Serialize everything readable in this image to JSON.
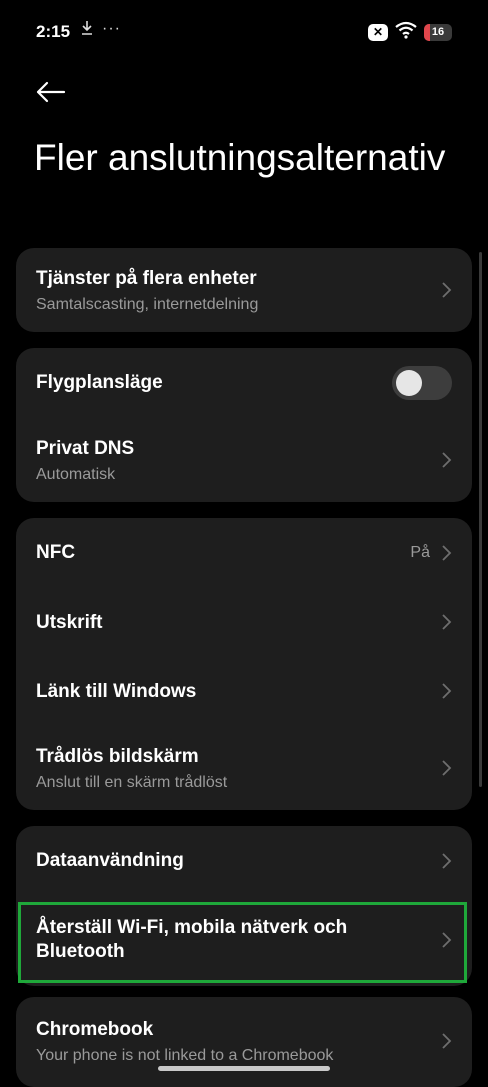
{
  "status_bar": {
    "time": "2:15",
    "download_icon": "download-icon",
    "more": "···",
    "battery_level": "16"
  },
  "header": {
    "title": "Fler anslutningsalternativ"
  },
  "sections": [
    {
      "items": [
        {
          "label": "Tjänster på flera enheter",
          "subtitle": "Samtalscasting, internetdelning"
        }
      ]
    },
    {
      "items": [
        {
          "label": "Flygplansläge",
          "toggle": false
        },
        {
          "label": "Privat DNS",
          "subtitle": "Automatisk"
        }
      ]
    },
    {
      "items": [
        {
          "label": "NFC",
          "value": "På"
        },
        {
          "label": "Utskrift"
        },
        {
          "label": "Länk till Windows"
        },
        {
          "label": "Trådlös bildskärm",
          "subtitle": "Anslut till en skärm trådlöst"
        }
      ]
    },
    {
      "items": [
        {
          "label": "Dataanvändning"
        },
        {
          "label": "Återställ Wi-Fi, mobila nätverk och Bluetooth",
          "highlighted": true
        }
      ]
    },
    {
      "items": [
        {
          "label": "Chromebook",
          "subtitle": "Your phone is not linked to a Chromebook"
        }
      ]
    }
  ],
  "colors": {
    "background": "#000000",
    "card": "#1e1e1e",
    "highlight": "#1fa83a",
    "battery_low": "#e0464c"
  }
}
